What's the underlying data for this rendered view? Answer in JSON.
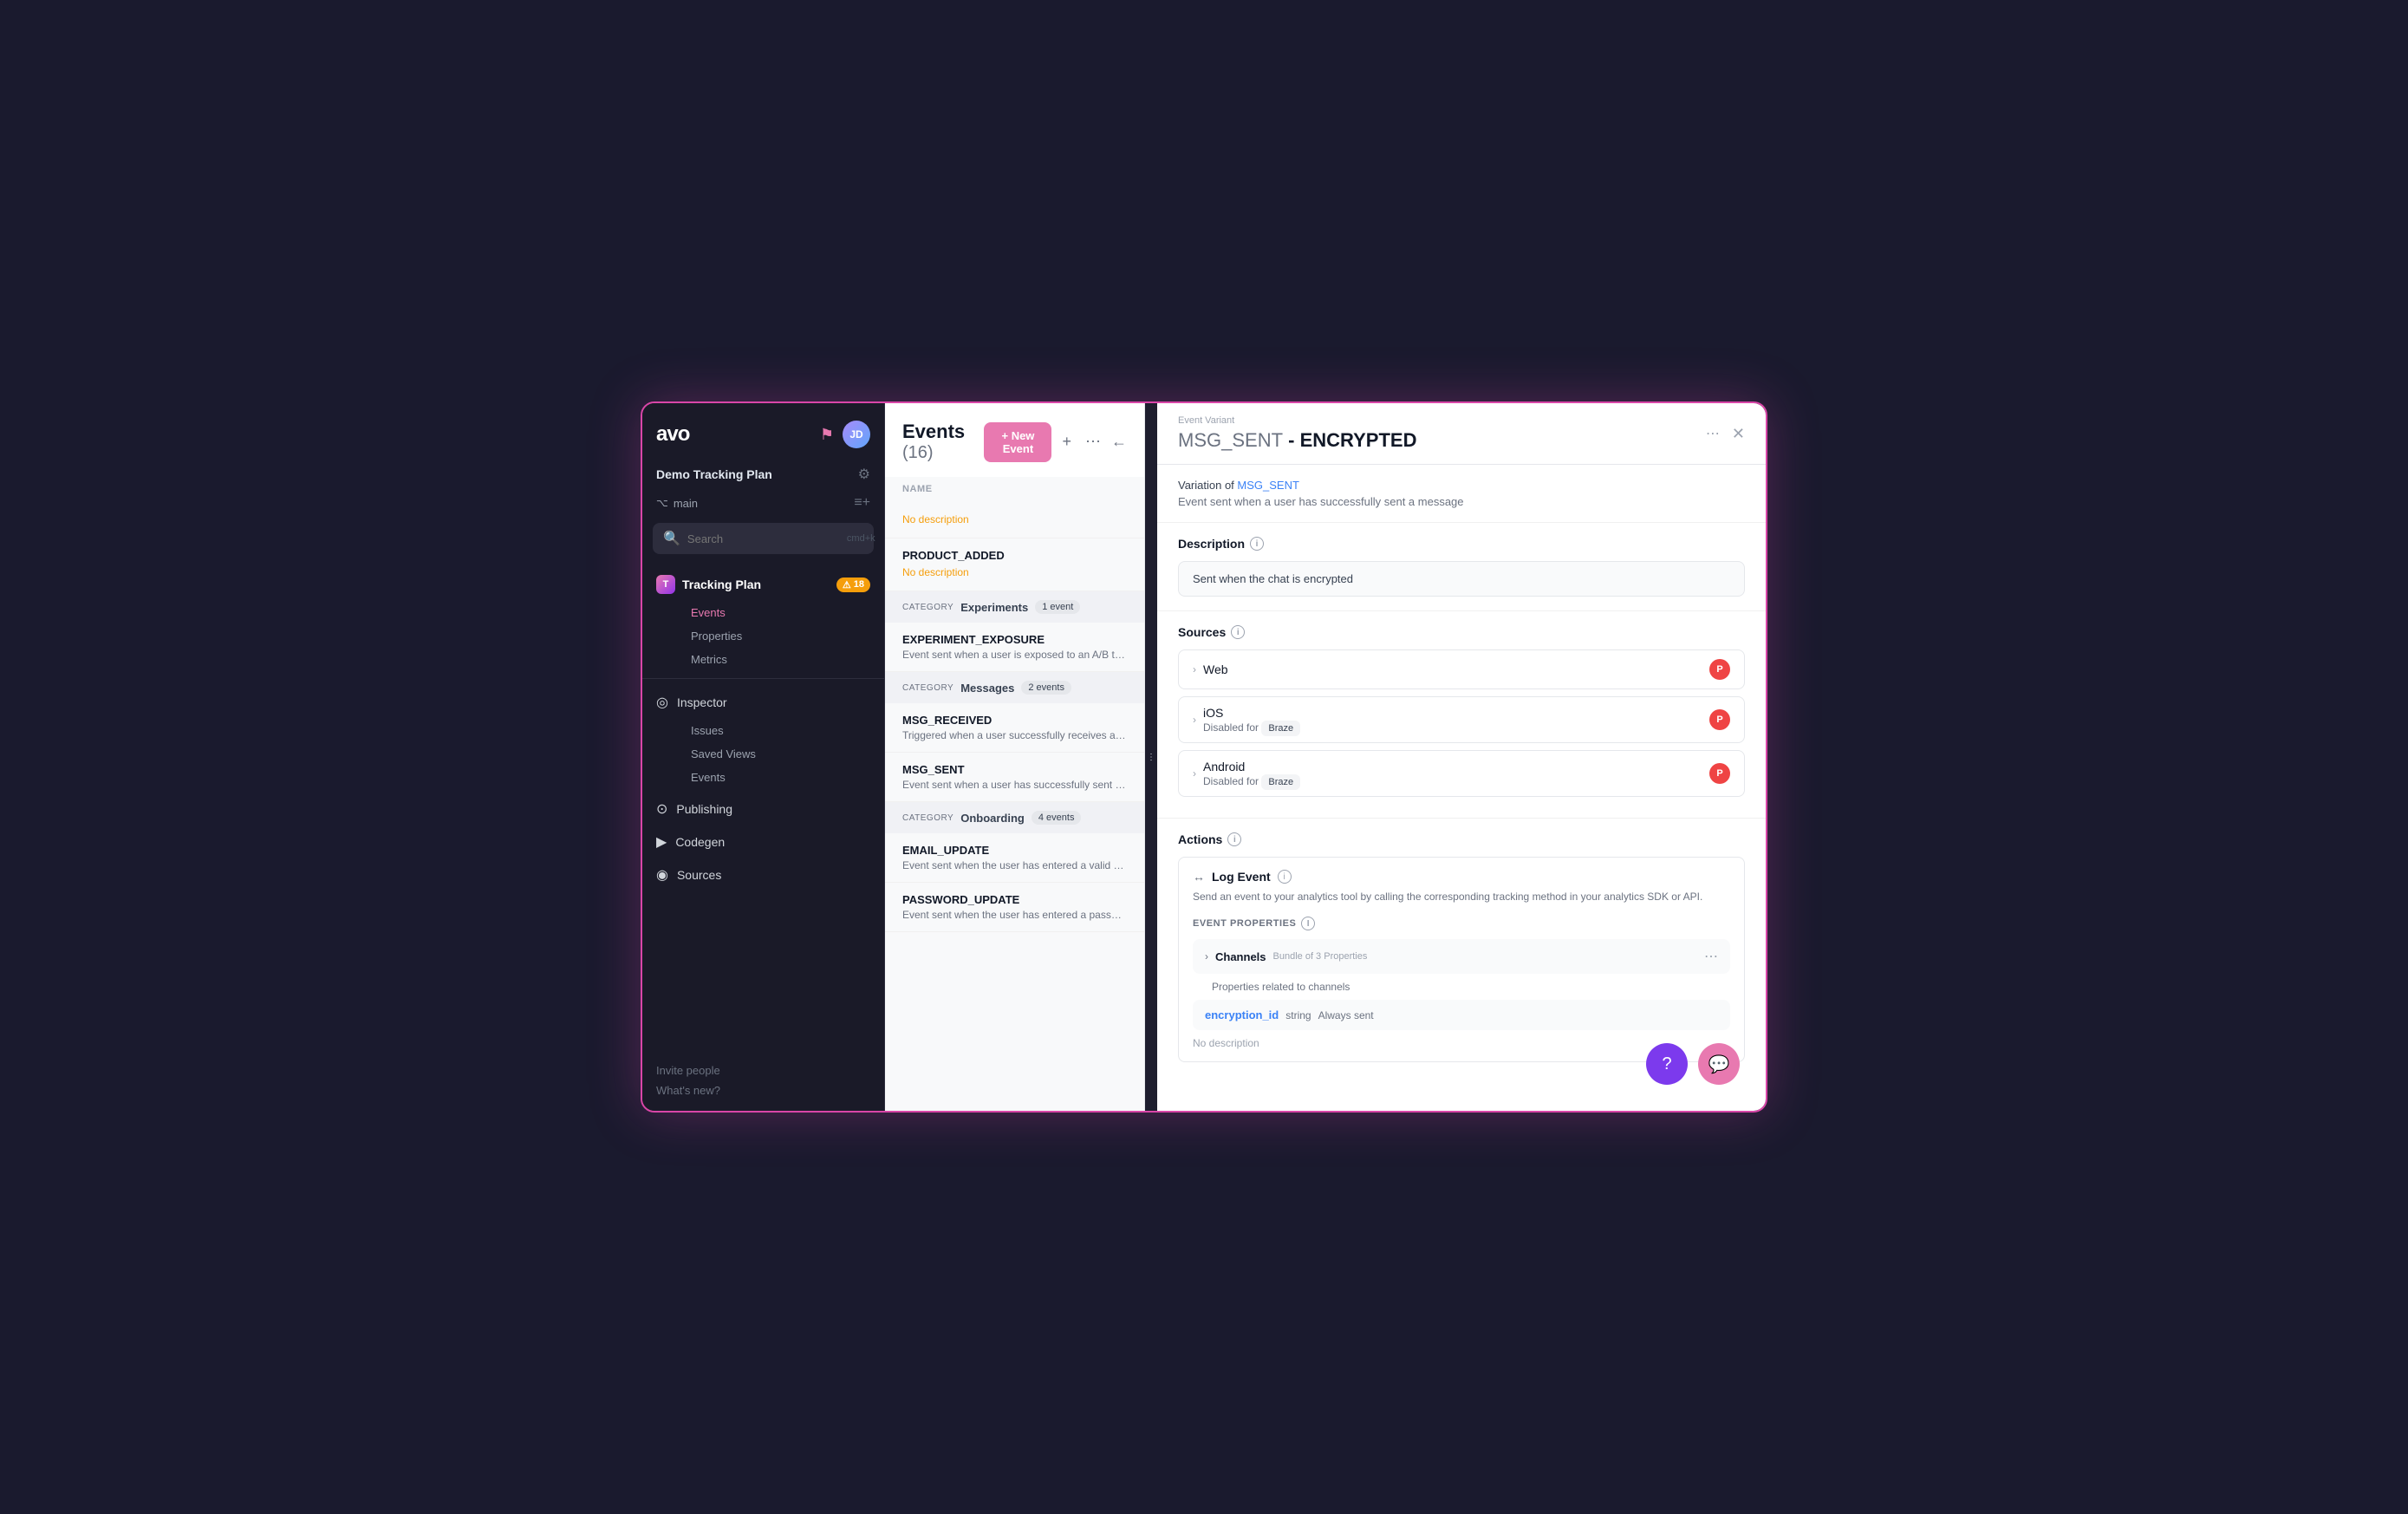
{
  "app": {
    "logo": "avo",
    "workspace": "Demo Tracking Plan",
    "branch": "main"
  },
  "sidebar": {
    "search_placeholder": "Search",
    "search_shortcut": "cmd+k",
    "tracking_plan": {
      "name": "Tracking Plan",
      "warning_count": "18",
      "sub_items": [
        "Events",
        "Properties",
        "Metrics"
      ]
    },
    "inspector": {
      "name": "Inspector",
      "sub_items": [
        "Issues",
        "Saved Views",
        "Events"
      ]
    },
    "publishing": "Publishing",
    "codegen": "Codegen",
    "sources": "Sources",
    "bottom_links": [
      "Invite people",
      "What's new?"
    ]
  },
  "events_panel": {
    "title": "Events",
    "count": "(16)",
    "new_event_label": "+ New Event",
    "column_header": "NAME",
    "no_desc_label": "No description",
    "items_before_categories": [
      {
        "name": "",
        "desc": "No description"
      },
      {
        "name": "PRODUCT_ADDED",
        "desc": "No description"
      }
    ],
    "categories": [
      {
        "label": "CATEGORY",
        "name": "Experiments",
        "count": "1 event",
        "events": [
          {
            "name": "EXPERIMENT_EXPOSURE",
            "desc": "Event sent when a user is exposed to an A/B tes..."
          }
        ]
      },
      {
        "label": "CATEGORY",
        "name": "Messages",
        "count": "2 events",
        "events": [
          {
            "name": "MSG_RECEIVED",
            "desc": "Triggered when a user successfully receives a m..."
          },
          {
            "name": "MSG_SENT",
            "desc": "Event sent when a user has successfully sent a..."
          }
        ]
      },
      {
        "label": "CATEGORY",
        "name": "Onboarding",
        "count": "4 events",
        "events": [
          {
            "name": "EMAIL_UPDATE",
            "desc": "Event sent when the user has entered a valid em..."
          },
          {
            "name": "PASSWORD_UPDATE",
            "desc": "Event sent when the user has entered a passwo..."
          }
        ]
      }
    ]
  },
  "detail": {
    "event_variant_label": "Event Variant",
    "title_prefix": "MSG_SENT",
    "title_suffix": "- ENCRYPTED",
    "variation_prefix": "Variation of",
    "variation_link": "MSG_SENT",
    "variation_desc": "Event sent when a user has successfully sent a message",
    "description_label": "Description",
    "description_value": "Sent when the chat is encrypted",
    "sources_label": "Sources",
    "sources": [
      {
        "name": "Web",
        "disabled": false,
        "disabled_for": ""
      },
      {
        "name": "iOS",
        "disabled": true,
        "disabled_for": "Braze"
      },
      {
        "name": "Android",
        "disabled": true,
        "disabled_for": "Braze"
      }
    ],
    "actions_label": "Actions",
    "actions_info": "ⓘ",
    "action": {
      "name": "Log Event",
      "desc": "Send an event to your analytics tool by calling the corresponding tracking method in your analytics SDK or API."
    },
    "event_properties_label": "EVENT PROPERTIES",
    "bundle": {
      "name": "Channels",
      "label": "Bundle of 3 Properties",
      "desc": "Properties related to channels"
    },
    "property": {
      "name": "encryption_id",
      "type": "string",
      "sent": "Always sent",
      "no_desc": "No description"
    }
  }
}
